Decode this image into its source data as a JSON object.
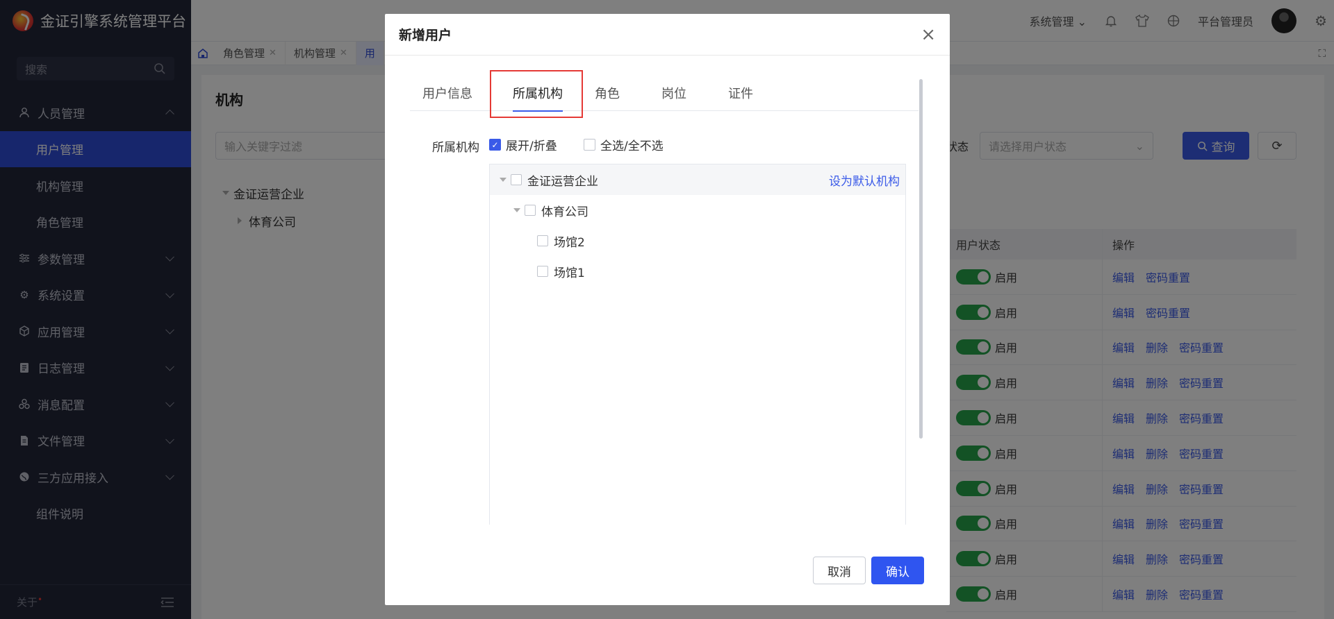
{
  "app": {
    "title": "金证引擎系统管理平台"
  },
  "sidebar": {
    "search_placeholder": "搜索",
    "items": [
      {
        "label": "人员管理",
        "icon": "user-icon",
        "expanded": true
      },
      {
        "label": "用户管理",
        "sub": true,
        "active": true
      },
      {
        "label": "机构管理",
        "sub": true
      },
      {
        "label": "角色管理",
        "sub": true
      },
      {
        "label": "参数管理",
        "icon": "sliders-icon"
      },
      {
        "label": "系统设置",
        "icon": "gear-icon"
      },
      {
        "label": "应用管理",
        "icon": "cube-icon"
      },
      {
        "label": "日志管理",
        "icon": "log-icon"
      },
      {
        "label": "消息配置",
        "icon": "message-icon"
      },
      {
        "label": "文件管理",
        "icon": "file-icon"
      },
      {
        "label": "三方应用接入",
        "icon": "globe-icon"
      },
      {
        "label": "组件说明",
        "sub": true
      }
    ],
    "about": "关于"
  },
  "header": {
    "system_menu": "系统管理",
    "user_name": "平台管理员"
  },
  "page_tabs": [
    "角色管理",
    "机构管理",
    "用"
  ],
  "main": {
    "title": "机构",
    "filter_placeholder": "输入关键字过滤",
    "tree": [
      "金证运营企业",
      "体育公司"
    ],
    "status_label": "状态",
    "status_placeholder": "请选择用户状态",
    "query_label": "查询",
    "table": {
      "headers": [
        "用户状态",
        "操作"
      ],
      "status_text": "启用",
      "edit": "编辑",
      "delete": "删除",
      "reset": "密码重置",
      "rows_without_delete": 2,
      "row_count": 10
    }
  },
  "modal": {
    "title": "新增用户",
    "tabs": [
      "用户信息",
      "所属机构",
      "角色",
      "岗位",
      "证件"
    ],
    "active_tab": "所属机构",
    "field_label": "所属机构",
    "expand_label": "展开/折叠",
    "select_all_label": "全选/全不选",
    "tree": {
      "root": "金证运营企业",
      "default_link": "设为默认机构",
      "child": "体育公司",
      "leaves": [
        "场馆2",
        "场馆1"
      ]
    },
    "cancel": "取消",
    "confirm": "确认"
  }
}
